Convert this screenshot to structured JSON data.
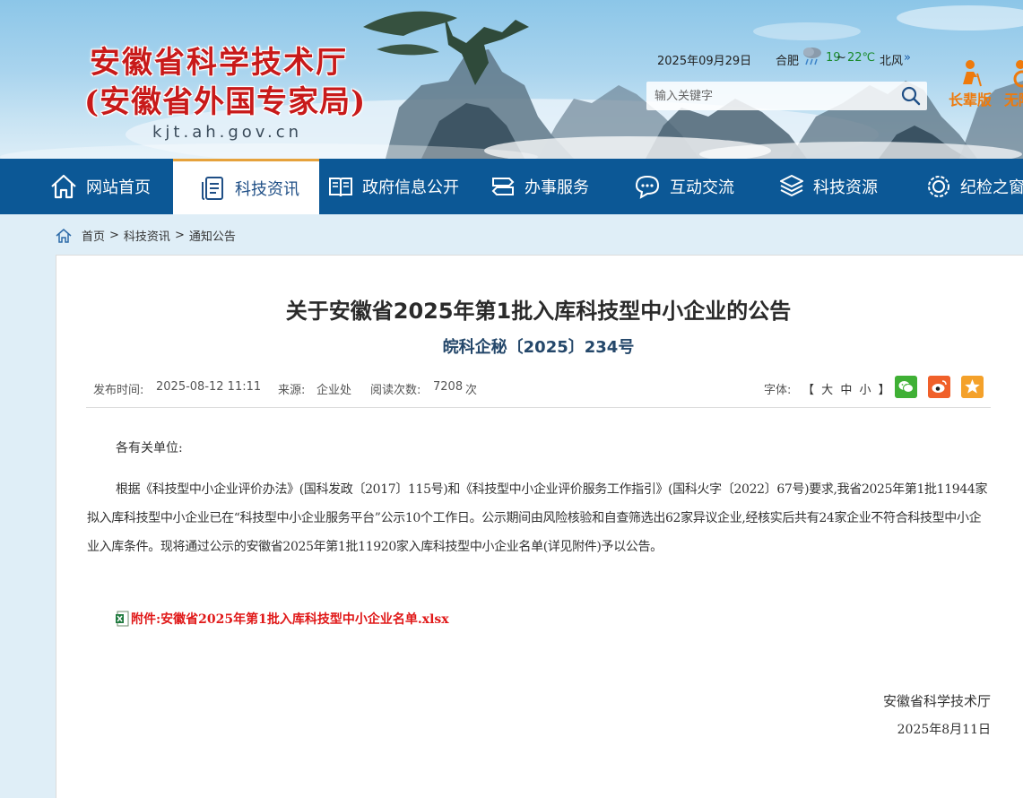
{
  "header": {
    "title": "安徽省科学技术厅",
    "subtitle": "(安徽省外国专家局)",
    "domain": "kjt.ah.gov.cn",
    "date": "2025年09月29日",
    "city": "合肥",
    "temp_low": "19",
    "temp_sep": "~",
    "temp_high": "22℃",
    "wind": "北风",
    "wind_arrow": "»",
    "search_placeholder": "输入关键字",
    "elder_mode": "长辈版",
    "barrier_free": "无障碍",
    "colors": {
      "title_red": "#c81a1a",
      "nav_blue": "#0c5896",
      "accent_orange": "#ee7a0c"
    }
  },
  "nav": {
    "items": [
      {
        "label": "网站首页",
        "icon": "home-icon"
      },
      {
        "label": "科技资讯",
        "icon": "document-icon",
        "active": true
      },
      {
        "label": "政府信息公开",
        "icon": "book-icon"
      },
      {
        "label": "办事服务",
        "icon": "signpost-icon"
      },
      {
        "label": "互动交流",
        "icon": "chat-icon"
      },
      {
        "label": "科技资源",
        "icon": "cube-icon"
      },
      {
        "label": "纪检之窗",
        "icon": "gear-badge-icon"
      }
    ]
  },
  "breadcrumb": [
    "首页",
    "科技资讯",
    "通知公告"
  ],
  "breadcrumb_sep": ">",
  "article": {
    "title": "关于安徽省2025年第1批入库科技型中小企业的公告",
    "doc_number": "皖科企秘〔2025〕234号",
    "publish_label": "发布时间:",
    "publish_time": "2025-08-12 11:11",
    "source_label": "来源:",
    "source": "企业处",
    "views_label": "阅读次数:",
    "views": "7208",
    "views_unit": "次",
    "font_label": "字体:",
    "font_open": "【",
    "font_large": "大",
    "font_medium": "中",
    "font_small": "小",
    "font_close": "】",
    "salutation": "各有关单位:",
    "body": "根据《科技型中小企业评价办法》(国科发政〔2017〕115号)和《科技型中小企业评价服务工作指引》(国科火字〔2022〕67号)要求,我省2025年第1批11944家拟入库科技型中小企业已在“科技型中小企业服务平台”公示10个工作日。公示期间由风险核验和自查筛选出62家异议企业,经核实后共有24家企业不符合科技型中小企业入库条件。现将通过公示的安徽省2025年第1批11920家入库科技型中小企业名单(详见附件)予以公告。",
    "attachment": "附件:安徽省2025年第1批入库科技型中小企业名单.xlsx",
    "signature_org": "安徽省科学技术厅",
    "signature_date": "2025年8月11日"
  }
}
